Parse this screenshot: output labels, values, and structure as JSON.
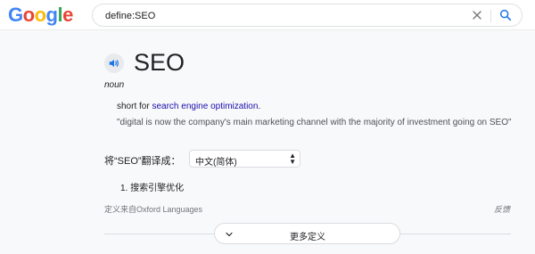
{
  "header": {
    "logo": [
      "G",
      "o",
      "o",
      "g",
      "l",
      "e"
    ],
    "logo_colors": [
      "#4285f4",
      "#ea4335",
      "#fbbc05",
      "#4285f4",
      "#34a853",
      "#ea4335"
    ],
    "search": {
      "value": "define:SEO"
    },
    "icons": {
      "clear": "close-icon",
      "search": "search-icon"
    }
  },
  "dictionary": {
    "word": "SEO",
    "part_of_speech": "noun",
    "definition_prefix": "short for ",
    "definition_link": "search engine optimization",
    "definition_suffix": ".",
    "example": "\"digital is now the company's main marketing channel with the majority of investment going on SEO\"",
    "translate_label": "将“SEO”翻译成：",
    "translate_language": "中文(简体)",
    "translations": [
      "1. 搜索引擎优化"
    ],
    "source": "定义来自Oxford Languages",
    "feedback": "反馈",
    "more_label": "更多定义"
  },
  "colors": {
    "link": "#1a0dab",
    "accent": "#1a73e8",
    "page_bg": "#f8f9fa"
  }
}
